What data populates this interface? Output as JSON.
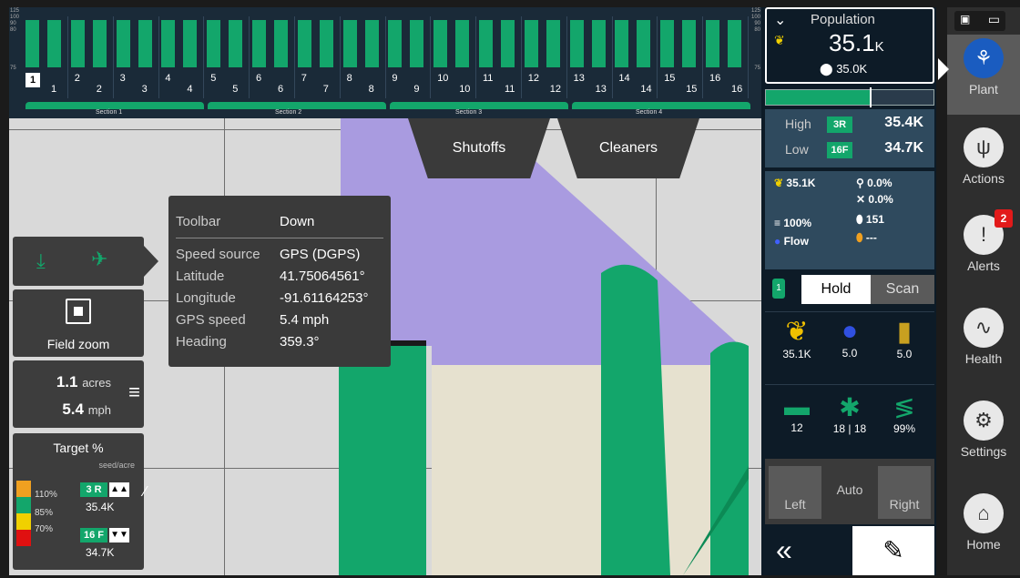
{
  "rowbar": {
    "scale_left": [
      "125",
      "100",
      "90",
      "80"
    ],
    "scale_left_low": "75",
    "scale_right": [
      "125",
      "100",
      "90",
      "80"
    ],
    "scale_right_low": "75",
    "selected_row": "1",
    "row_labels": [
      "1",
      "2",
      "3",
      "4",
      "5",
      "6",
      "7",
      "8",
      "9",
      "10",
      "11",
      "12",
      "13",
      "14",
      "15",
      "16"
    ],
    "sections": [
      "Section 1",
      "Section 2",
      "Section 3",
      "Section 4"
    ]
  },
  "tabs": {
    "shutoffs": "Shutoffs",
    "cleaners": "Cleaners"
  },
  "left": {
    "field_zoom": "Field zoom",
    "acres_value": "1.1",
    "acres_unit": "acres",
    "speed_value": "5.4",
    "speed_unit": "mph",
    "target_title": "Target %",
    "target_sub": "seed/acre",
    "legend": [
      "110%",
      "85%",
      "70%"
    ],
    "high_row": "3 R",
    "high_value": "35.4K",
    "low_row": "16 F",
    "low_value": "34.7K"
  },
  "info": {
    "rows": [
      {
        "label": "Toolbar",
        "value": "Down"
      },
      {
        "label": "Speed source",
        "value": "GPS (DGPS)"
      },
      {
        "label": "Latitude",
        "value": "41.75064561°"
      },
      {
        "label": "Longitude",
        "value": "-91.61164253°"
      },
      {
        "label": "GPS speed",
        "value": "5.4 mph"
      },
      {
        "label": "Heading",
        "value": "359.3°"
      }
    ]
  },
  "right": {
    "population_title": "Population",
    "population_value": "35.1",
    "population_unit": "K",
    "population_target": "35.0K",
    "high_label": "High",
    "high_row": "3R",
    "high_value": "35.4K",
    "low_label": "Low",
    "low_row": "16F",
    "low_value": "34.7K",
    "stats": {
      "pop": "35.1K",
      "singulation": "100%",
      "flow": "Flow",
      "skip": "0.0%",
      "multiple": "0.0%",
      "count": "151",
      "other": "---"
    },
    "hold": "Hold",
    "scan": "Scan",
    "hold_badge": "1",
    "metrics": [
      {
        "icon": "corn-icon",
        "value": "35.1K"
      },
      {
        "icon": "drop-icon",
        "value": "5.0"
      },
      {
        "icon": "seed-icon",
        "value": "5.0"
      }
    ],
    "metrics2": [
      {
        "icon": "tank-icon",
        "value": "12"
      },
      {
        "icon": "fan-icon",
        "value": "18 | 18"
      },
      {
        "icon": "spring-icon",
        "value": "99%"
      }
    ],
    "left_btn": "Left",
    "auto_btn": "Auto",
    "right_btn": "Right"
  },
  "nav": {
    "plant": "Plant",
    "actions": "Actions",
    "alerts": "Alerts",
    "alerts_badge": "2",
    "health": "Health",
    "settings": "Settings",
    "home": "Home"
  },
  "colors": {
    "green": "#13a66b",
    "purple": "#a99be0",
    "planted": "#e6e1cf",
    "navy": "#0d1b27"
  }
}
